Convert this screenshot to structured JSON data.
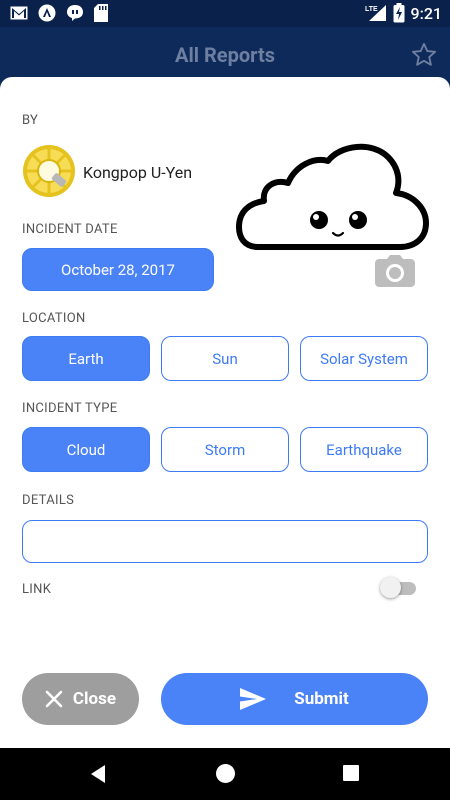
{
  "status_bar": {
    "time": "9:21",
    "network": "LTE",
    "battery_level": "charging",
    "notification_icons": [
      "gmail-icon",
      "app-a-icon",
      "chat-icon",
      "sd-card-icon"
    ]
  },
  "app_bar": {
    "title": "All Reports",
    "favorite_icon": "star-outline-icon"
  },
  "form": {
    "by_label": "BY",
    "user_name": "Kongpop U-Yen",
    "incident_date_label": "INCIDENT DATE",
    "incident_date_value": "October 28, 2017",
    "location_label": "LOCATION",
    "location_options": [
      {
        "label": "Earth",
        "selected": true
      },
      {
        "label": "Sun",
        "selected": false
      },
      {
        "label": "Solar System",
        "selected": false
      }
    ],
    "incident_type_label": "INCIDENT TYPE",
    "incident_type_options": [
      {
        "label": "Cloud",
        "selected": true
      },
      {
        "label": "Storm",
        "selected": false
      },
      {
        "label": "Earthquake",
        "selected": false
      }
    ],
    "details_label": "DETAILS",
    "details_value": "",
    "link_label": "LINK",
    "link_enabled": false
  },
  "actions": {
    "close_label": "Close",
    "submit_label": "Submit"
  },
  "colors": {
    "primary": "#4a82f7",
    "header": "#0d2a5b",
    "close_button": "#9e9e9e"
  }
}
